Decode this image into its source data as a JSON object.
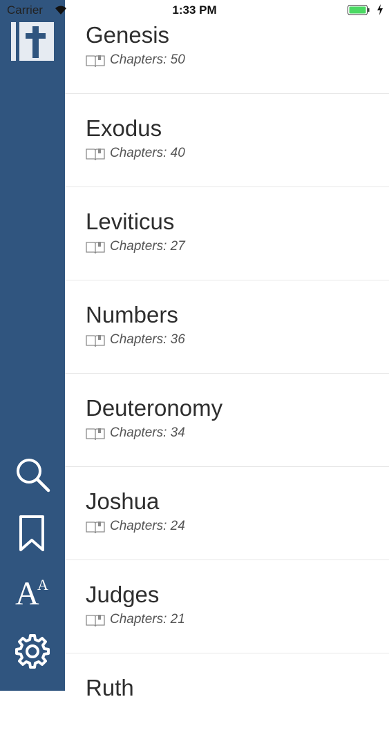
{
  "status_bar": {
    "carrier": "Carrier",
    "time": "1:33 PM",
    "battery_color": "#4cd964"
  },
  "sidebar": {
    "background": "#30557f",
    "logo_icon": "bible-cross-logo",
    "icons": [
      "search-icon",
      "bookmark-icon",
      "font-size-icon",
      "gear-icon"
    ],
    "font_icon": {
      "large": "A",
      "small": "A"
    }
  },
  "books": [
    {
      "title": "Genesis",
      "chapters": "Chapters: 50"
    },
    {
      "title": "Exodus",
      "chapters": "Chapters: 40"
    },
    {
      "title": "Leviticus",
      "chapters": "Chapters: 27"
    },
    {
      "title": "Numbers",
      "chapters": "Chapters: 36"
    },
    {
      "title": "Deuteronomy",
      "chapters": "Chapters: 34"
    },
    {
      "title": "Joshua",
      "chapters": "Chapters: 24"
    },
    {
      "title": "Judges",
      "chapters": "Chapters: 21"
    },
    {
      "title": "Ruth",
      "chapters": ""
    }
  ]
}
